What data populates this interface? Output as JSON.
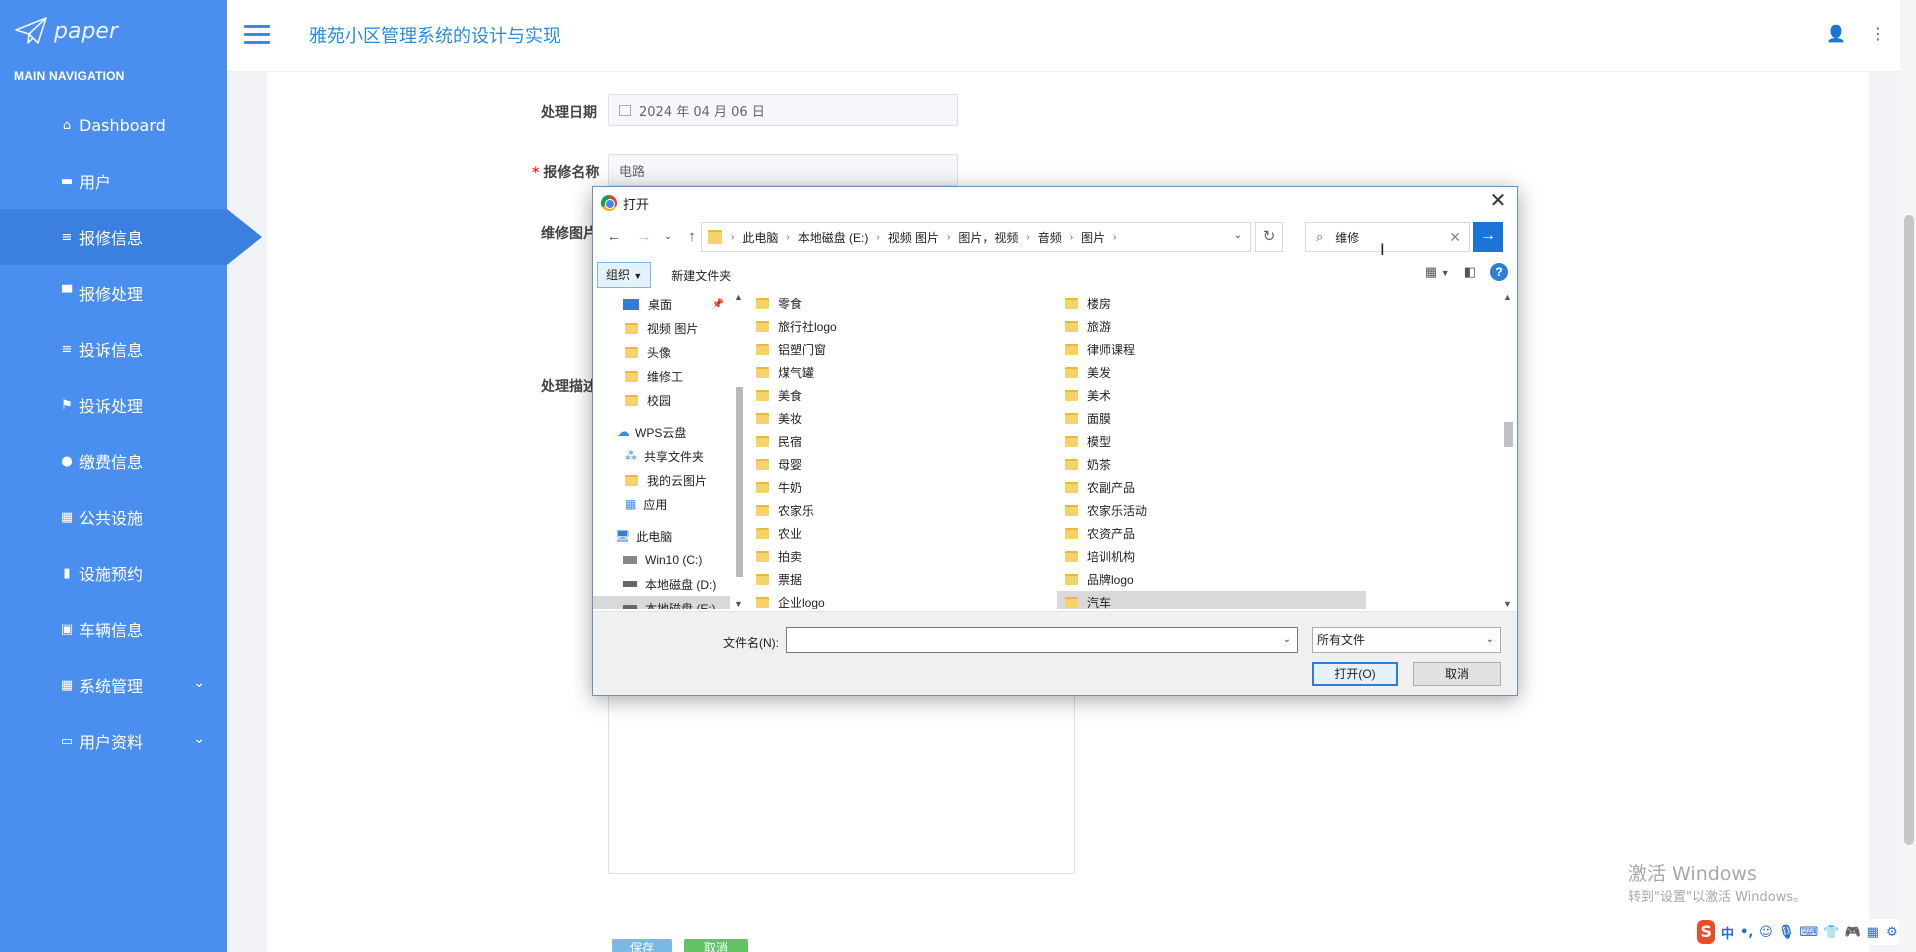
{
  "sidebar": {
    "logo_text": "paper",
    "section_label": "MAIN NAVIGATION",
    "items": [
      {
        "label": "Dashboard",
        "icon": "home-icon"
      },
      {
        "label": "用户",
        "icon": "id-card-icon"
      },
      {
        "label": "报修信息",
        "icon": "list-icon"
      },
      {
        "label": "报修处理",
        "icon": "monitor-icon"
      },
      {
        "label": "投诉信息",
        "icon": "list-icon"
      },
      {
        "label": "投诉处理",
        "icon": "flag-icon"
      },
      {
        "label": "缴费信息",
        "icon": "user-icon"
      },
      {
        "label": "公共设施",
        "icon": "grid-icon"
      },
      {
        "label": "设施预约",
        "icon": "book-icon"
      },
      {
        "label": "车辆信息",
        "icon": "clipboard-icon"
      },
      {
        "label": "系统管理",
        "icon": "grid-icon"
      },
      {
        "label": "用户资料",
        "icon": "card-icon"
      }
    ],
    "active_index": 2
  },
  "header": {
    "title": "雅苑小区管理系统的设计与实现"
  },
  "form": {
    "date_label": "处理日期",
    "date_value": "2024 年 04 月 06 日",
    "name_label": "报修名称",
    "name_value": "电路",
    "image_label": "维修图片",
    "desc_label": "处理描述",
    "save_label": "保存",
    "cancel_label": "取消"
  },
  "dialog": {
    "title": "打开",
    "breadcrumb": [
      "此电脑",
      "本地磁盘 (E:)",
      "视频 图片",
      "图片，视频",
      "音频",
      "图片"
    ],
    "search_value": "维修",
    "organize_label": "组织",
    "new_folder_label": "新建文件夹",
    "tree": [
      {
        "label": "桌面",
        "indent": 1,
        "icon": "desktop-icon"
      },
      {
        "label": "视频 图片",
        "indent": 1,
        "icon": "folder-icon"
      },
      {
        "label": "头像",
        "indent": 1,
        "icon": "folder-icon"
      },
      {
        "label": "维修工",
        "indent": 1,
        "icon": "folder-icon"
      },
      {
        "label": "校园",
        "indent": 1,
        "icon": "folder-icon"
      },
      {
        "label": "",
        "indent": 0,
        "icon": ""
      },
      {
        "label": "WPS云盘",
        "indent": 0,
        "icon": "cloud-icon"
      },
      {
        "label": "共享文件夹",
        "indent": 1,
        "icon": "share-icon"
      },
      {
        "label": "我的云图片",
        "indent": 1,
        "icon": "folder-icon"
      },
      {
        "label": "应用",
        "indent": 1,
        "icon": "apps-icon"
      },
      {
        "label": "",
        "indent": 0,
        "icon": ""
      },
      {
        "label": "此电脑",
        "indent": 0,
        "icon": "computer-icon"
      },
      {
        "label": "Win10 (C:)",
        "indent": 1,
        "icon": "drive-icon"
      },
      {
        "label": "本地磁盘 (D:)",
        "indent": 1,
        "icon": "drive-icon"
      },
      {
        "label": "本地磁盘 (E:)",
        "indent": 1,
        "icon": "drive-icon"
      }
    ],
    "files_col1": [
      "零食",
      "旅行社logo",
      "铝塑门窗",
      "煤气罐",
      "美食",
      "美妆",
      "民宿",
      "母婴",
      "牛奶",
      "农家乐",
      "农业",
      "拍卖",
      "票据",
      "企业logo"
    ],
    "files_col2": [
      "楼房",
      "旅游",
      "律师课程",
      "美发",
      "美术",
      "面膜",
      "模型",
      "奶茶",
      "农副产品",
      "农家乐活动",
      "农资产品",
      "培训机构",
      "品牌logo",
      "汽车"
    ],
    "filename_label": "文件名(N):",
    "filename_value": "",
    "filetype_value": "所有文件",
    "open_label": "打开(O)",
    "cancel_label": "取消"
  },
  "watermark": {
    "line1": "激活 Windows",
    "line2": "转到\"设置\"以激活 Windows。"
  },
  "tray": {
    "ime": "中"
  }
}
